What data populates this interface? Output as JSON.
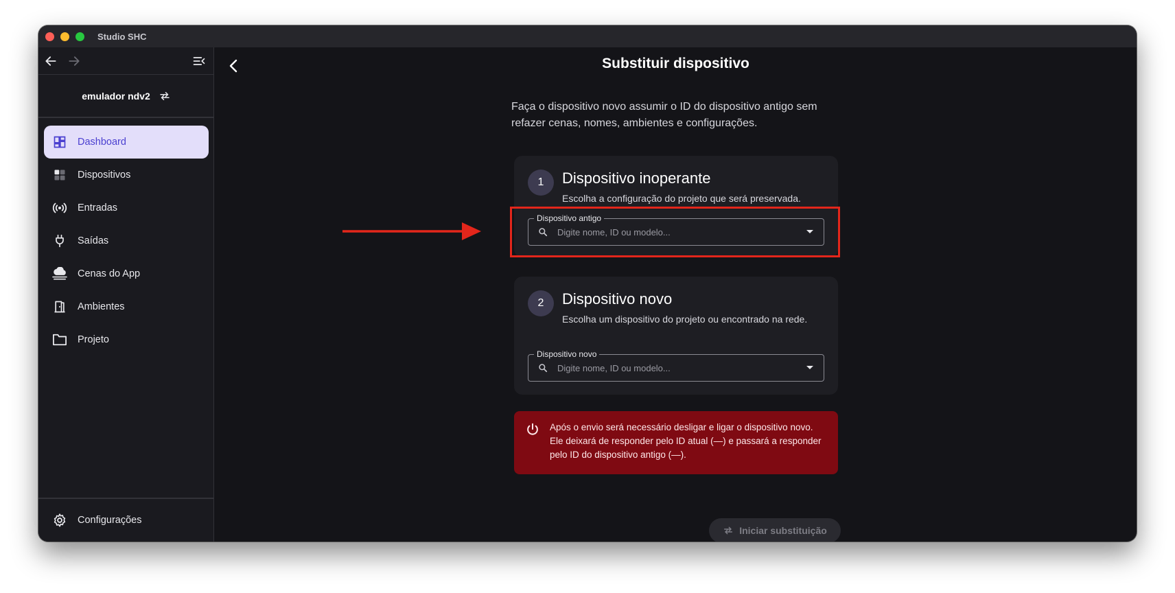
{
  "window": {
    "title": "Studio SHC"
  },
  "sidebar": {
    "project_name": "emulador ndv2",
    "items": [
      {
        "label": "Dashboard",
        "icon": "dashboard-icon",
        "active": true
      },
      {
        "label": "Dispositivos",
        "icon": "devices-grid-icon",
        "active": false
      },
      {
        "label": "Entradas",
        "icon": "broadcast-icon",
        "active": false
      },
      {
        "label": "Saídas",
        "icon": "plug-icon",
        "active": false
      },
      {
        "label": "Cenas do App",
        "icon": "cloud-icon",
        "active": false
      },
      {
        "label": "Ambientes",
        "icon": "door-icon",
        "active": false
      },
      {
        "label": "Projeto",
        "icon": "folder-icon",
        "active": false
      }
    ],
    "settings_label": "Configurações"
  },
  "main": {
    "title": "Substituir dispositivo",
    "intro": "Faça o dispositivo novo assumir o ID do dispositivo antigo sem refazer cenas, nomes, ambientes e configurações.",
    "step1": {
      "number": "1",
      "title": "Dispositivo inoperante",
      "subtitle": "Escolha a configuração do projeto que será preservada.",
      "field_label": "Dispositivo antigo",
      "placeholder": "Digite nome, ID ou modelo..."
    },
    "step2": {
      "number": "2",
      "title": "Dispositivo novo",
      "subtitle": "Escolha um dispositivo do projeto ou encontrado na rede.",
      "field_label": "Dispositivo novo",
      "placeholder": "Digite nome, ID ou modelo..."
    },
    "warning": "Após o envio será necessário desligar e ligar o dispositivo novo. Ele deixará de responder pelo ID atual (—) e passará a responder pelo ID do dispositivo antigo (—).",
    "start_button": "Iniciar substituição"
  },
  "colors": {
    "accent": "#4a3fd0",
    "active_bg": "#e3defa",
    "warning_bg": "#7f0a12",
    "annotation": "#e3261b"
  }
}
